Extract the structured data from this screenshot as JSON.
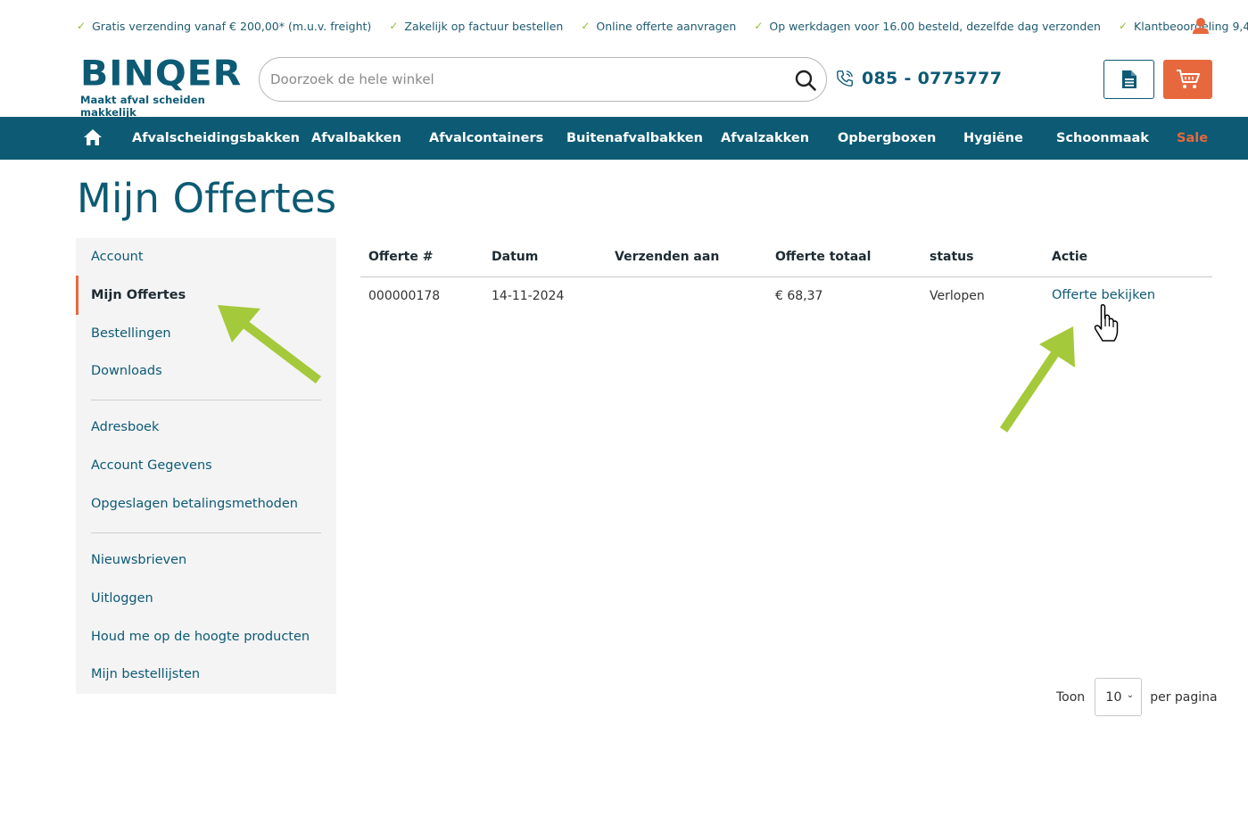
{
  "usp": [
    "Gratis verzending vanaf € 200,00* (m.u.v. freight)",
    "Zakelijk op factuur bestellen",
    "Online offerte aanvragen",
    "Op werkdagen voor 16.00 besteld, dezelfde dag verzonden",
    "Klantbeoordeling 9,4"
  ],
  "header": {
    "logo_text": "BINQER",
    "logo_tagline": "Maakt afval scheiden makkelijk",
    "search_placeholder": "Doorzoek de hele winkel",
    "phone": "085 - 0775777"
  },
  "nav": {
    "items": [
      "Afvalscheidingsbakken",
      "Afvalbakken",
      "Afvalcontainers",
      "Buitenafvalbakken",
      "Afvalzakken",
      "Opbergboxen",
      "Hygiëne",
      "Schoonmaak",
      "Sale"
    ]
  },
  "page_title": "Mijn Offertes",
  "sidebar": {
    "items": [
      "Account",
      "Mijn Offertes",
      "Bestellingen",
      "Downloads",
      "Adresboek",
      "Account Gegevens",
      "Opgeslagen betalingsmethoden",
      "Nieuwsbrieven",
      "Uitloggen",
      "Houd me op de hoogte producten",
      "Mijn bestellijsten"
    ],
    "active": "Mijn Offertes"
  },
  "table": {
    "headers": [
      "Offerte #",
      "Datum",
      "Verzenden aan",
      "Offerte totaal",
      "status",
      "Actie"
    ],
    "rows": [
      {
        "number": "000000178",
        "date": "14-11-2024",
        "ship_to": "",
        "total": "€ 68,37",
        "status": "Verlopen",
        "action": "Offerte bekijken"
      }
    ]
  },
  "pager": {
    "show_label": "Toon",
    "per_page_value": "10",
    "per_page_label": "per pagina"
  },
  "colors": {
    "brand": "#0c5a73",
    "accent": "#e8683e",
    "check": "#8cbf3a",
    "annotation_arrow": "#a4c93a"
  }
}
